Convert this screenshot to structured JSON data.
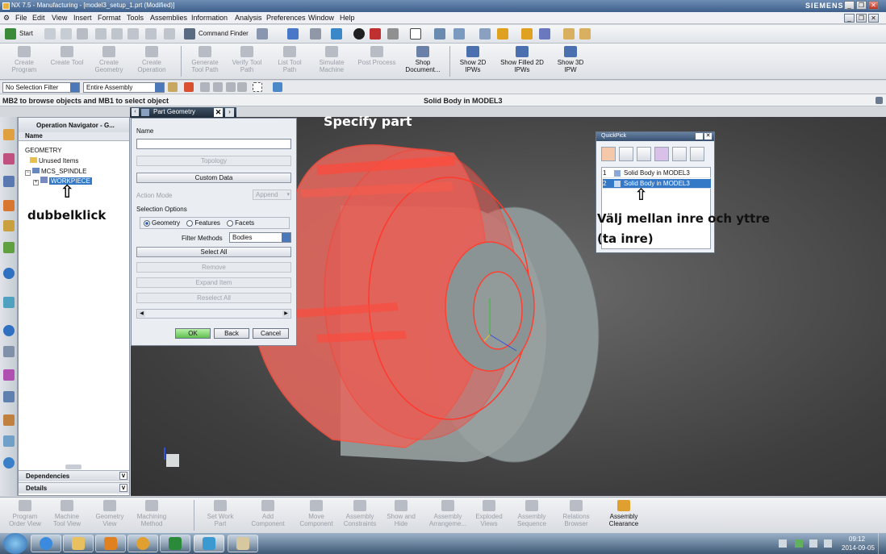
{
  "window": {
    "title": "NX 7.5 - Manufacturing - [model3_setup_1.prt (Modified)]",
    "brand": "SIEMENS"
  },
  "menu": [
    "File",
    "Edit",
    "View",
    "Insert",
    "Format",
    "Tools",
    "Assemblies",
    "Information",
    "Analysis",
    "Preferences",
    "Window",
    "Help"
  ],
  "toolbar1": {
    "start_label": "Start",
    "command_finder_label": "Command Finder"
  },
  "toolbar2": [
    {
      "label": "Create Program",
      "enabled": false
    },
    {
      "label": "Create Tool",
      "enabled": false
    },
    {
      "label": "Create Geometry",
      "enabled": false
    },
    {
      "label": "Create Operation",
      "enabled": false
    },
    {
      "label": "Generate Tool Path",
      "enabled": false
    },
    {
      "label": "Verify Tool Path",
      "enabled": false
    },
    {
      "label": "List Tool Path",
      "enabled": false
    },
    {
      "label": "Simulate Machine",
      "enabled": false
    },
    {
      "label": "Post Process",
      "enabled": false
    },
    {
      "label": "Shop Document...",
      "enabled": true
    },
    {
      "label": "Show 2D IPWs",
      "enabled": true
    },
    {
      "label": "Show Filled 2D IPWs",
      "enabled": true
    },
    {
      "label": "Show 3D IPW",
      "enabled": true
    }
  ],
  "selection": {
    "filter": "No Selection Filter",
    "scope": "Entire Assembly"
  },
  "status": {
    "prompt": "MB2 to browse objects and MB1 to select object",
    "selection": "Solid Body in MODEL3"
  },
  "navigator": {
    "title": "Operation Navigator - G...",
    "column": "Name",
    "rows": [
      "GEOMETRY",
      "Unused Items",
      "MCS_SPINDLE",
      "WORKPIECE"
    ],
    "footer": [
      "Dependencies",
      "Details"
    ]
  },
  "dialog": {
    "title": "Part Geometry",
    "name_label": "Name",
    "name_value": "",
    "topology": "Topology",
    "custom_data": "Custom Data",
    "action_mode": "Action Mode",
    "append": "Append",
    "selection_options": "Selection Options",
    "radio_geometry": "Geometry",
    "radio_features": "Features",
    "radio_facets": "Facets",
    "filter_methods_label": "Filter Methods",
    "filter_methods_value": "Bodies",
    "select_all": "Select All",
    "remove": "Remove",
    "expand_item": "Expand Item",
    "reselect_all": "Reselect All",
    "ok": "OK",
    "back": "Back",
    "cancel": "Cancel"
  },
  "quickpick": {
    "title": "QuickPick",
    "items": [
      {
        "num": "1",
        "label": "Solid Body in MODEL3",
        "selected": false
      },
      {
        "num": "2",
        "label": "Solid Body in MODEL3",
        "selected": true
      }
    ]
  },
  "annotations": {
    "specify_part": "Specify part",
    "double_click": "dubbelklick",
    "choose_line1": "Välj mellan inre och yttre",
    "choose_line2": "(ta inre)"
  },
  "bottombar": [
    {
      "label": "Program Order View"
    },
    {
      "label": "Machine Tool View"
    },
    {
      "label": "Geometry View"
    },
    {
      "label": "Machining Method"
    },
    {
      "label": "Set Work Part"
    },
    {
      "label": "Add Component"
    },
    {
      "label": "Move Component"
    },
    {
      "label": "Assembly Constraints"
    },
    {
      "label": "Show and Hide"
    },
    {
      "label": "Assembly Arrangeme..."
    },
    {
      "label": "Exploded Views"
    },
    {
      "label": "Assembly Sequence"
    },
    {
      "label": "Relations Browser"
    },
    {
      "label": "Assembly Clearance"
    }
  ],
  "taskbar": {
    "time": "09:12",
    "date": "2014-09-05"
  },
  "colors": {
    "accent": "#3478c8",
    "part_red": "#e04848",
    "viewport": "#4a4a4a"
  }
}
